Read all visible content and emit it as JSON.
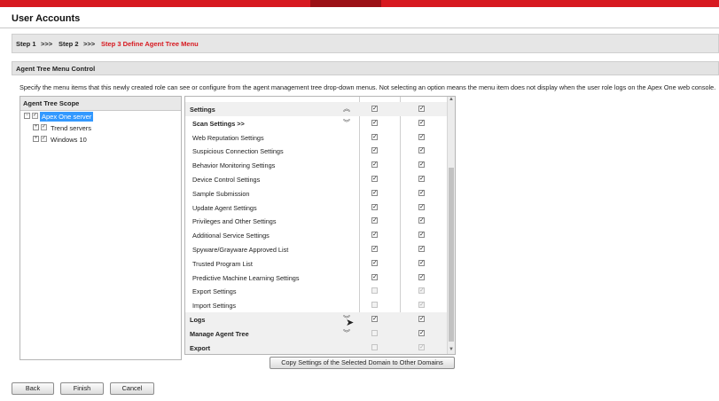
{
  "page": {
    "title": "User Accounts"
  },
  "steps": {
    "step1": "Step 1",
    "sep1": ">>>",
    "step2": "Step 2",
    "sep2": ">>>",
    "step3": "Step 3  Define Agent Tree Menu"
  },
  "section": {
    "title": "Agent Tree Menu Control"
  },
  "description": "Specify the menu items that this newly created role can see or configure from the agent management tree drop-down menus. Not selecting an option means the menu item does not display when the user role logs on the Apex One web console.",
  "scope": {
    "header": "Agent Tree Scope",
    "nodes": [
      {
        "label": "Apex One server",
        "selected": true
      },
      {
        "label": "Trend servers"
      },
      {
        "label": "Windows 10"
      }
    ]
  },
  "menu_items": [
    {
      "label": "Settings",
      "kind": "group",
      "chevron": "up",
      "col1": "checked",
      "col2": "checked"
    },
    {
      "label": "Scan Settings >>",
      "kind": "sub",
      "chevron": "down",
      "col1": "checked",
      "col2": "checked"
    },
    {
      "label": "Web Reputation Settings",
      "kind": "item",
      "col1": "checked",
      "col2": "checked"
    },
    {
      "label": "Suspicious Connection Settings",
      "kind": "item",
      "col1": "checked",
      "col2": "checked"
    },
    {
      "label": "Behavior Monitoring Settings",
      "kind": "item",
      "col1": "checked",
      "col2": "checked"
    },
    {
      "label": "Device Control Settings",
      "kind": "item",
      "col1": "checked",
      "col2": "checked"
    },
    {
      "label": "Sample Submission",
      "kind": "item",
      "col1": "checked",
      "col2": "checked"
    },
    {
      "label": "Update Agent Settings",
      "kind": "item",
      "col1": "checked",
      "col2": "checked"
    },
    {
      "label": "Privileges and Other Settings",
      "kind": "item",
      "col1": "checked",
      "col2": "checked"
    },
    {
      "label": "Additional Service Settings",
      "kind": "item",
      "col1": "checked",
      "col2": "checked"
    },
    {
      "label": "Spyware/Grayware Approved List",
      "kind": "item",
      "col1": "checked",
      "col2": "checked"
    },
    {
      "label": "Trusted Program List",
      "kind": "item",
      "col1": "checked",
      "col2": "checked"
    },
    {
      "label": "Predictive Machine Learning Settings",
      "kind": "item",
      "col1": "checked",
      "col2": "checked"
    },
    {
      "label": "Export Settings",
      "kind": "item",
      "col1": "disabled",
      "col2": "disabled-checked"
    },
    {
      "label": "Import Settings",
      "kind": "item",
      "col1": "disabled",
      "col2": "disabled-checked"
    },
    {
      "label": "Logs",
      "kind": "group",
      "chevron": "down",
      "col1": "checked",
      "col2": "checked"
    },
    {
      "label": "Manage Agent Tree",
      "kind": "group",
      "chevron": "down",
      "col1": "disabled",
      "col2": "checked"
    },
    {
      "label": "Export",
      "kind": "group",
      "col1": "disabled",
      "col2": "disabled-checked"
    }
  ],
  "copy_button": "Copy Settings of the Selected Domain to Other Domains",
  "buttons": {
    "back": "Back",
    "finish": "Finish",
    "cancel": "Cancel"
  },
  "icons": {
    "expand": "plus-box-icon",
    "collapse_up": "double-chevron-up-icon",
    "collapse_down": "double-chevron-down-icon",
    "cursor": "mouse-pointer-icon"
  },
  "colors": {
    "brand_red": "#d71920",
    "active_tab": "#9b1116",
    "selection": "#3399ff",
    "step_current": "#d71920"
  }
}
